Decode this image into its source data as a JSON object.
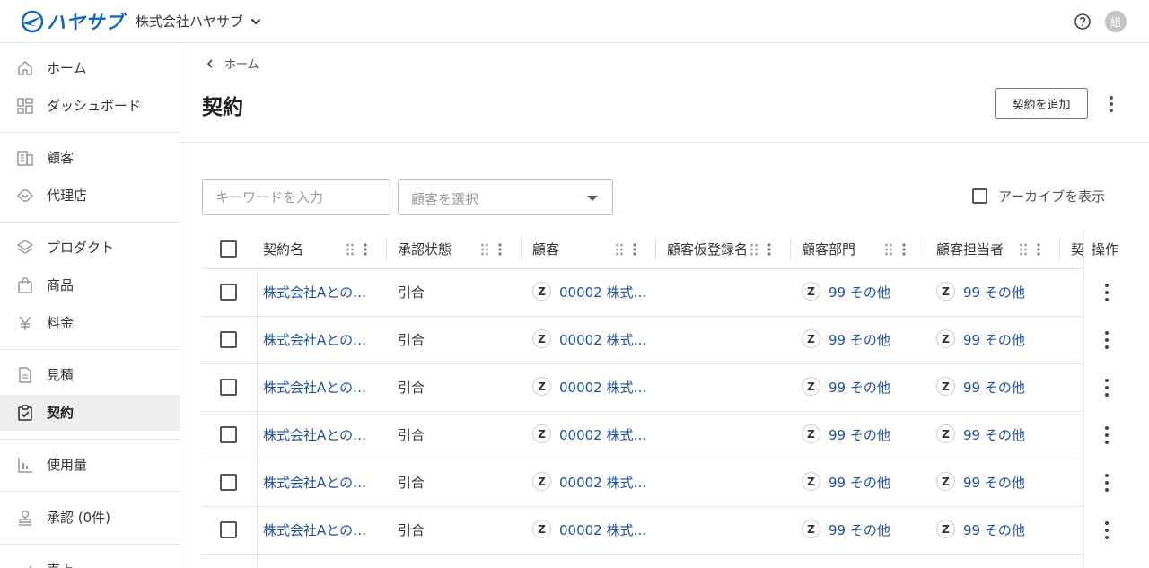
{
  "app": {
    "logo_text": "ハヤサブ",
    "company_name": "株式会社ハヤサブ",
    "avatar_text": "組"
  },
  "sidebar": {
    "items": [
      {
        "label": "ホーム",
        "icon": "home-icon"
      },
      {
        "label": "ダッシュボード",
        "icon": "dashboard-icon"
      },
      {
        "label": "顧客",
        "icon": "customer-icon"
      },
      {
        "label": "代理店",
        "icon": "agency-icon"
      },
      {
        "label": "プロダクト",
        "icon": "product-icon"
      },
      {
        "label": "商品",
        "icon": "item-icon"
      },
      {
        "label": "料金",
        "icon": "yen-icon"
      },
      {
        "label": "見積",
        "icon": "quote-icon"
      },
      {
        "label": "契約",
        "icon": "contract-icon",
        "active": true
      },
      {
        "label": "使用量",
        "icon": "usage-icon"
      },
      {
        "label": "承認 (0件)",
        "icon": "approval-icon"
      },
      {
        "label": "売上",
        "icon": "sales-icon"
      }
    ]
  },
  "main": {
    "breadcrumb": "ホーム",
    "title": "契約",
    "add_button": "契約を追加",
    "filters": {
      "keyword_placeholder": "キーワードを入力",
      "customer_placeholder": "顧客を選択",
      "archive_label": "アーカイブを表示"
    },
    "table": {
      "columns": [
        "契約名",
        "承認状態",
        "顧客",
        "顧客仮登録名",
        "顧客部門",
        "顧客担当者",
        "契",
        "操作"
      ],
      "rows": [
        {
          "name": "株式会社Aとの…",
          "status": "引合",
          "customer_badge": "Z",
          "customer": "00002 株式…",
          "temp_name": "",
          "dept_badge": "Z",
          "dept": "99 その他",
          "rep_badge": "Z",
          "rep": "99 その他"
        },
        {
          "name": "株式会社Aとの…",
          "status": "引合",
          "customer_badge": "Z",
          "customer": "00002 株式…",
          "temp_name": "",
          "dept_badge": "Z",
          "dept": "99 その他",
          "rep_badge": "Z",
          "rep": "99 その他"
        },
        {
          "name": "株式会社Aとの…",
          "status": "引合",
          "customer_badge": "Z",
          "customer": "00002 株式…",
          "temp_name": "",
          "dept_badge": "Z",
          "dept": "99 その他",
          "rep_badge": "Z",
          "rep": "99 その他"
        },
        {
          "name": "株式会社Aとの…",
          "status": "引合",
          "customer_badge": "Z",
          "customer": "00002 株式…",
          "temp_name": "",
          "dept_badge": "Z",
          "dept": "99 その他",
          "rep_badge": "Z",
          "rep": "99 その他"
        },
        {
          "name": "株式会社Aとの…",
          "status": "引合",
          "customer_badge": "Z",
          "customer": "00002 株式…",
          "temp_name": "",
          "dept_badge": "Z",
          "dept": "99 その他",
          "rep_badge": "Z",
          "rep": "99 その他"
        },
        {
          "name": "株式会社Aとの…",
          "status": "引合",
          "customer_badge": "Z",
          "customer": "00002 株式…",
          "temp_name": "",
          "dept_badge": "Z",
          "dept": "99 その他",
          "rep_badge": "Z",
          "rep": "99 その他"
        }
      ]
    }
  },
  "colors": {
    "accent": "#1565c0",
    "link": "#1a4f9c",
    "active_bg": "#eeeeee"
  }
}
